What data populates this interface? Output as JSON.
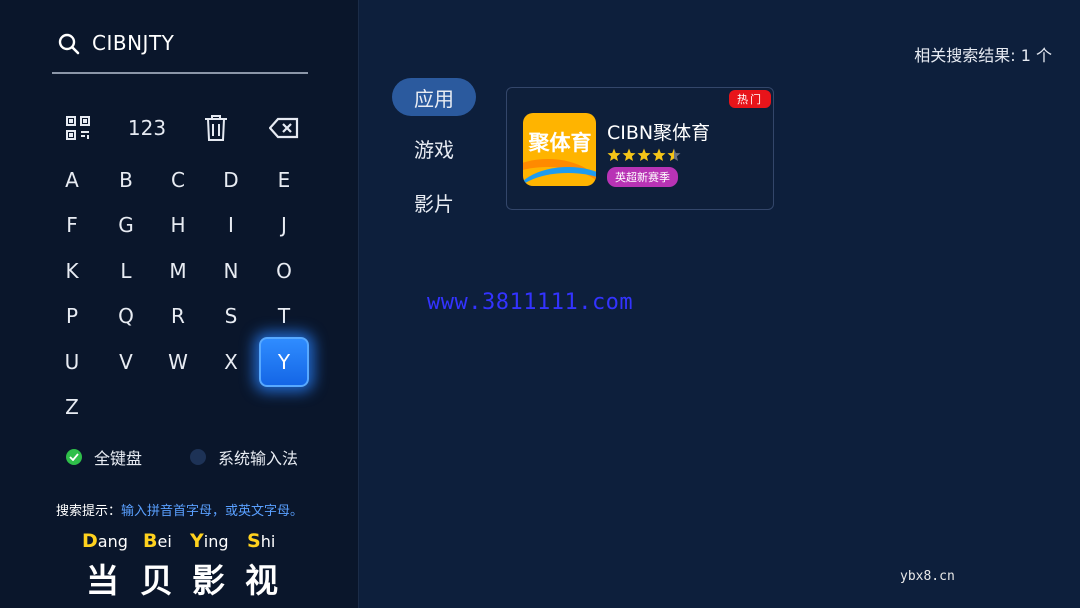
{
  "search": {
    "query": "CIBNJTY"
  },
  "toolbar": {
    "numbers_label": "123"
  },
  "keyboard": {
    "active_key": "Y",
    "rows": [
      [
        "A",
        "B",
        "C",
        "D",
        "E"
      ],
      [
        "F",
        "G",
        "H",
        "I",
        "J"
      ],
      [
        "K",
        "L",
        "M",
        "N",
        "O"
      ],
      [
        "P",
        "Q",
        "R",
        "S",
        "T"
      ],
      [
        "U",
        "V",
        "W",
        "X",
        "Y"
      ],
      [
        "Z"
      ]
    ]
  },
  "input_modes": {
    "full_keyboard": "全键盘",
    "system_ime": "系统输入法"
  },
  "hint": {
    "label": "搜索提示：",
    "text": "输入拼音首字母，或英文字母。"
  },
  "brand": {
    "pinyin": [
      {
        "initial": "D",
        "rest": "ang"
      },
      {
        "initial": "B",
        "rest": "ei"
      },
      {
        "initial": "Y",
        "rest": "ing"
      },
      {
        "initial": "S",
        "rest": "hi"
      }
    ],
    "chinese": [
      "当",
      "贝",
      "影",
      "视"
    ]
  },
  "result_count": "相关搜索结果: 1 个",
  "categories": [
    {
      "label": "应用",
      "active": true
    },
    {
      "label": "游戏",
      "active": false
    },
    {
      "label": "影片",
      "active": false
    }
  ],
  "results": [
    {
      "name": "CIBN聚体育",
      "icon_text": "聚体育",
      "badge": "热门",
      "rating": 4.5,
      "tag": "英超新赛季"
    }
  ],
  "watermarks": {
    "center": "www.3811111.com",
    "corner": "ybx8.cn"
  },
  "colors": {
    "accent": "#2f8cff",
    "hot": "#e8141a",
    "tag": "#b833b5",
    "star": "#f5c518",
    "check": "#2fbf4a"
  }
}
